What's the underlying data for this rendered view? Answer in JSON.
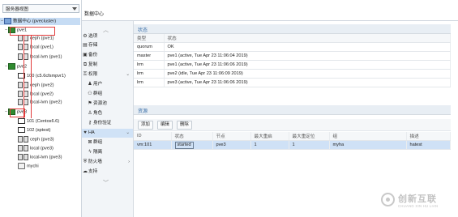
{
  "tree": {
    "view_selector": "服务器视图",
    "items": [
      {
        "label": "数据中心 (pvecluster)",
        "kind": "dc"
      },
      {
        "label": "pve1",
        "kind": "node"
      },
      {
        "label": "ceph (pve1)",
        "kind": "store"
      },
      {
        "label": "local (pve1)",
        "kind": "store"
      },
      {
        "label": "local-lvm (pve1)",
        "kind": "store"
      },
      {
        "label": "pve2",
        "kind": "node"
      },
      {
        "label": "100 (c5.6cfsmpvr1)",
        "kind": "vm"
      },
      {
        "label": "ceph (pve2)",
        "kind": "store"
      },
      {
        "label": "local (pve2)",
        "kind": "store"
      },
      {
        "label": "local-lvm (pve2)",
        "kind": "store"
      },
      {
        "label": "pve3",
        "kind": "node"
      },
      {
        "label": "101 (Centos6.6)",
        "kind": "vm"
      },
      {
        "label": "102 (sptest)",
        "kind": "vm"
      },
      {
        "label": "ceph (pve3)",
        "kind": "store"
      },
      {
        "label": "local (pve3)",
        "kind": "store"
      },
      {
        "label": "local-lvm (pve3)",
        "kind": "store"
      },
      {
        "label": "mychi",
        "kind": "pool"
      }
    ]
  },
  "header": {
    "title": "数据中心"
  },
  "nav": {
    "items": [
      {
        "label": "选项",
        "icon": "gear-icon",
        "glyph": "⚙"
      },
      {
        "label": "存储",
        "icon": "database-icon",
        "glyph": "▤"
      },
      {
        "label": "备份",
        "icon": "floppy-icon",
        "glyph": "▣"
      },
      {
        "label": "复制",
        "icon": "copy-icon",
        "glyph": "⧉"
      },
      {
        "label": "权限",
        "icon": "unlock-icon",
        "glyph": "🔓"
      },
      {
        "label": "用户",
        "icon": "user-icon",
        "glyph": "♟"
      },
      {
        "label": "群组",
        "icon": "users-icon",
        "glyph": "⚇"
      },
      {
        "label": "资源池",
        "icon": "tags-icon",
        "glyph": "⚑"
      },
      {
        "label": "角色",
        "icon": "male-icon",
        "glyph": "♙"
      },
      {
        "label": "身份验证",
        "icon": "key-icon",
        "glyph": "⚷"
      },
      {
        "label": "HA",
        "icon": "heartbeat-icon",
        "glyph": "♥"
      },
      {
        "label": "群组",
        "icon": "object-group-icon",
        "glyph": "⊠"
      },
      {
        "label": "隔离",
        "icon": "bolt-icon",
        "glyph": "ϟ"
      },
      {
        "label": "防火墙",
        "icon": "shield-icon",
        "glyph": "⛨"
      },
      {
        "label": "支持",
        "icon": "comment-icon",
        "glyph": "☁"
      }
    ]
  },
  "status": {
    "section_title": "状态",
    "columns": [
      "类型",
      "状态"
    ],
    "rows": [
      [
        "quorum",
        "OK"
      ],
      [
        "master",
        "pve1 (active, Tue Apr 23 11:06:04 2019)"
      ],
      [
        "lrm",
        "pve1 (active, Tue Apr 23 11:06:06 2019)"
      ],
      [
        "lrm",
        "pve2 (idle, Tue Apr 23 11:06:09 2019)"
      ],
      [
        "lrm",
        "pve3 (active, Tue Apr 23 11:06:06 2019)"
      ]
    ]
  },
  "resources": {
    "section_title": "资源",
    "toolbar": {
      "add": "添加",
      "edit": "编辑",
      "remove": "删除"
    },
    "columns": [
      "ID",
      "状态",
      "节点",
      "最大重启",
      "最大重定位",
      "组",
      "描述"
    ],
    "rows": [
      [
        "vm:101",
        "started",
        "pve3",
        "1",
        "1",
        "myha",
        "hatest"
      ]
    ]
  },
  "watermark": {
    "cn": "创新互联",
    "en": "CHUANG XIN HU LIAN"
  }
}
